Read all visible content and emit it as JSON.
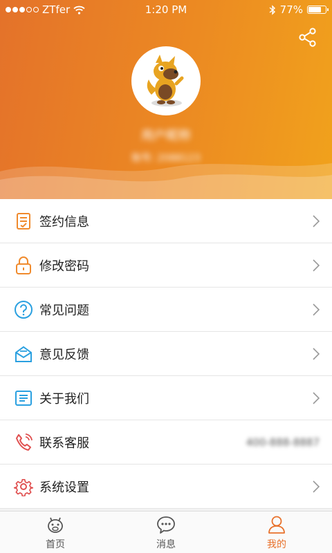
{
  "status_bar": {
    "carrier": "ZTfer",
    "time": "1:20 PM",
    "battery": "77%",
    "battery_level": 0.77
  },
  "profile": {
    "username": "用户昵称",
    "account": "账号: 2088123"
  },
  "menu": [
    {
      "label": "签约信息",
      "icon": "contract-icon"
    },
    {
      "label": "修改密码",
      "icon": "lock-icon"
    },
    {
      "label": "常见问题",
      "icon": "question-icon"
    },
    {
      "label": "意见反馈",
      "icon": "mail-icon"
    },
    {
      "label": "关于我们",
      "icon": "document-icon"
    },
    {
      "label": "联系客服",
      "icon": "phone-icon",
      "value": "400-888-8887"
    },
    {
      "label": "系统设置",
      "icon": "gear-icon"
    }
  ],
  "tabbar": {
    "tabs": [
      {
        "label": "首页",
        "icon": "home-mascot-icon",
        "active": false
      },
      {
        "label": "消息",
        "icon": "chat-icon",
        "active": false
      },
      {
        "label": "我的",
        "icon": "person-icon",
        "active": true
      }
    ]
  },
  "colors": {
    "accent": "#e8712b",
    "header_start": "#e4722a",
    "header_end": "#f1a21c"
  }
}
